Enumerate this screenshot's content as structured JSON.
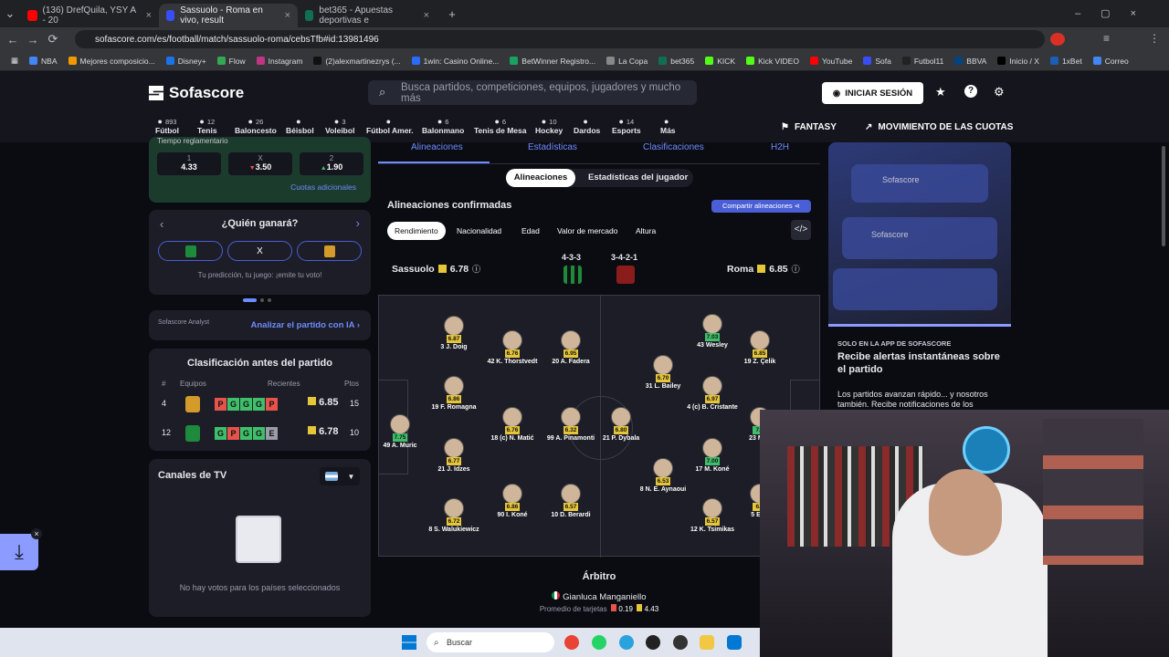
{
  "browser": {
    "tabs": [
      {
        "label": "(136) DrefQuila, YSY A - 20",
        "active": false,
        "color": "#ff0000"
      },
      {
        "label": "Sassuolo - Roma en vivo, result",
        "active": true,
        "color": "#374df5"
      },
      {
        "label": "bet365 - Apuestas deportivas e",
        "active": false,
        "color": "#126e51"
      }
    ],
    "url": "sofascore.com/es/football/match/sassuolo-roma/cebsTfb#id:13981496",
    "bookmarks": [
      "NBA",
      "Mejores composicio...",
      "Disney+",
      "Flow",
      "Instagram",
      "(2)alexmartinezrys (...",
      "1win: Casino Online...",
      "BetWinner Registro...",
      "La Copa",
      "bet365",
      "KICK",
      "Kick VIDEO",
      "YouTube",
      "Sofa",
      "Futbol11",
      "BBVA",
      "Inicio / X",
      "1xBet",
      "Correo"
    ]
  },
  "header": {
    "logo": "Sofascore",
    "search_placeholder": "Busca partidos, competiciones, equipos, jugadores y mucho más",
    "login": "INICIAR SESIÓN"
  },
  "sports": [
    {
      "label": "Fútbol",
      "count": "893"
    },
    {
      "label": "Tenis",
      "count": "12"
    },
    {
      "label": "Baloncesto",
      "count": "26"
    },
    {
      "label": "Béisbol",
      "count": ""
    },
    {
      "label": "Voleibol",
      "count": "3"
    },
    {
      "label": "Fútbol Amer.",
      "count": ""
    },
    {
      "label": "Balonmano",
      "count": "6"
    },
    {
      "label": "Tenis de Mesa",
      "count": "6"
    },
    {
      "label": "Hockey",
      "count": "10"
    },
    {
      "label": "Dardos",
      "count": ""
    },
    {
      "label": "Esports",
      "count": "14"
    },
    {
      "label": "Más",
      "count": ""
    }
  ],
  "rightnav": {
    "fantasy": "FANTASY",
    "odds": "MOVIMIENTO DE LAS CUOTAS"
  },
  "odds": {
    "label": "Tiempo reglamentario",
    "items": [
      {
        "k": "1",
        "v": "4.33"
      },
      {
        "k": "X",
        "v": "3.50"
      },
      {
        "k": "2",
        "v": "1.90"
      }
    ],
    "more": "Cuotas adicionales"
  },
  "predict": {
    "title": "¿Quién ganará?",
    "draw": "X",
    "note": "Tu predicción, tu juego: ¡emite tu voto!"
  },
  "analyst": {
    "brand": "Sofascore Analyst",
    "cta": "Analizar el partido con IA"
  },
  "standings": {
    "title": "Clasificación antes del partido",
    "cols": [
      "#",
      "Equipos",
      "Recientes",
      "Ptos"
    ],
    "rows": [
      {
        "pos": "4",
        "form": [
          "P",
          "G",
          "G",
          "G",
          "P"
        ],
        "rating": "6.85",
        "pts": "15"
      },
      {
        "pos": "12",
        "form": [
          "G",
          "P",
          "G",
          "G",
          "E"
        ],
        "rating": "6.78",
        "pts": "10"
      }
    ]
  },
  "tv": {
    "title": "Canales de TV",
    "empty": "No hay votos para los países seleccionados"
  },
  "match_tabs": [
    "Alineaciones",
    "Estadísticas",
    "Clasificaciones",
    "H2H"
  ],
  "subtabs": [
    "Alineaciones",
    "Estadísticas del jugador"
  ],
  "lineups": {
    "title": "Alineaciones confirmadas",
    "share": "Compartir alineaciones",
    "filters": [
      "Rendimiento",
      "Nacionalidad",
      "Edad",
      "Valor de mercado",
      "Altura"
    ],
    "home": {
      "name": "Sassuolo",
      "rating": "6.78",
      "formation": "4-3-3"
    },
    "away": {
      "name": "Roma",
      "rating": "6.85",
      "formation": "3-4-2-1"
    },
    "players": [
      {
        "n": "49 A. Muric",
        "r": "7.75"
      },
      {
        "n": "3 J. Doig",
        "r": "6.87"
      },
      {
        "n": "19 F. Romagna",
        "r": "6.86"
      },
      {
        "n": "21 J. Idzes",
        "r": "6.77"
      },
      {
        "n": "8 S. Walukiewicz",
        "r": "6.72"
      },
      {
        "n": "42 K. Thorstvedt",
        "r": "6.76"
      },
      {
        "n": "18 (c) N. Matić",
        "r": "6.76"
      },
      {
        "n": "90 I. Koné",
        "r": "6.86"
      },
      {
        "n": "20 A. Fadera",
        "r": "6.95"
      },
      {
        "n": "99 A. Pinamonti",
        "r": "6.32"
      },
      {
        "n": "10 D. Berardi",
        "r": "6.57"
      },
      {
        "n": "21 P. Dybala",
        "r": "6.80"
      },
      {
        "n": "31 L. Bailey",
        "r": "6.70"
      },
      {
        "n": "8 N. E. Aynaoui",
        "r": "6.53"
      },
      {
        "n": "43 Wesley",
        "r": "7.03"
      },
      {
        "n": "4 (c) B. Cristante",
        "r": "6.97"
      },
      {
        "n": "17 M. Koné",
        "r": "7.00"
      },
      {
        "n": "12 K. Tsimikas",
        "r": "6.57"
      },
      {
        "n": "19 Z. Çelik",
        "r": "6.85"
      },
      {
        "n": "23 Man",
        "r": "7.1"
      },
      {
        "n": "5 E. N",
        "r": "6.9"
      }
    ]
  },
  "referee": {
    "title": "Árbitro",
    "name": "Gianluca Manganiello",
    "cards_label": "Promedio de tarjetas",
    "red": "0.19",
    "yellow": "4.43"
  },
  "promo": {
    "tag": "SOLO EN LA APP DE SOFASCORE",
    "title": "Recibe alertas instantáneas sobre el partido",
    "body": "Los partidos avanzan rápido... y nosotros también. Recibe notificaciones de los",
    "app": "Sofascore"
  },
  "taskbar": {
    "search": "Buscar"
  }
}
